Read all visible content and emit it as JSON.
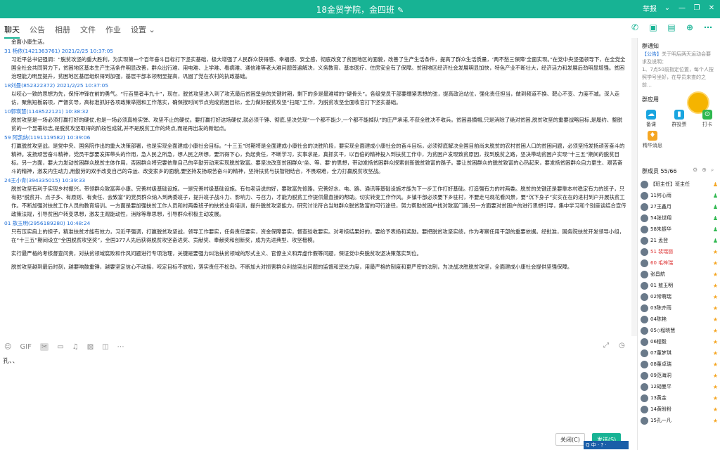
{
  "window": {
    "title": "18金贸学院，金四班",
    "edit_icon": "pencil-icon"
  },
  "window_controls": [
    "举报",
    "⌄",
    "—",
    "❐",
    "✕"
  ],
  "tabs": [
    "聊天",
    "公告",
    "相册",
    "文件",
    "作业",
    "设置 ⌄"
  ],
  "active_tab": "聊天",
  "quick_tools": [
    "phone-icon",
    "video-icon",
    "screen-share-icon",
    "add-icon",
    "more-icon"
  ],
  "messages": [
    {
      "name": "",
      "time": "",
      "lines": [
        "金面小康生活。"
      ]
    },
    {
      "name": "31  杨依(1421363761)",
      "time": "2021/2/25 10:37:05",
      "lines": [
        "习近平总书记强调：“脱贫攻坚的重大胜利，为实现第一个百年奋斗目标打下坚实基础，极大增强了人民群众获得感、幸福感、安全感，彻底改变了贫困地区的面貌，改善了生产生活条件，提高了群众生活质量，‘两不愁三保障’全面实现。”在党中央坚强领导下，在全党全国全社会共同努力下，贫困地区基本生产生活条件明显改善，群众出行难、用电难、上学难、看病难、通信难等老大难问题普遍解决，义务教育、基本医疗、住房安全有了保障。贫困地区经济社会发展明显加快，特色产业不断壮大，经济活力和发展后劲明显增强。贫困治理能力明显提升，贫困地区基层组织得到加强，基层干部本领明显提高，巩固了党在农村的执政基础。"
      ]
    },
    {
      "name": "18刘曼(852322372)",
      "time": "2021/2/25 10:37:05",
      "lines": [
        "以咬心一致的思想为先，保持冲锋在前的勇气。“行百里者半九十”，现在，脱贫攻坚进入到了攻克最后贫困堡垒的关键时期，剩下的多是最难啃的“硬骨头”。各级党员干部要绷紧思想的弦，提高政治站位，强化责任担当，做到频道不换、靶心不变、力度不减。深入走访，聚焦短板弱项，严督实导，高标准抓好各项政策举措和工作落实，确保按时间节点完成贫困目标，全力做好脱贫攻坚“扫尾”工作，为脱贫攻坚全面收官打下坚实基础。"
      ]
    },
    {
      "name": "10郭瑛慧(1148522121)",
      "time": "10:38:32",
      "lines": [
        "脱贫攻坚是一场必须打赢打好的硬仗,也是一场必须真枪实弹、攻坚不止的硬仗。要打赢打好这场硬仗,就必须千锤、彻底,坚决兑现“一个都不能少,一个都不能掉队”的庄严承诺,不获全胜决不收兵。贫困县摘帽,只是消除了绝对贫困,脱贫攻坚的重要战略目标,是履约、整脱贫的一个显著标志,是脱贫攻坚取得的阶段性成就,并不是脱贫工作的终点,而是再出发的新起点。"
      ]
    },
    {
      "name": "59  阿凯纳(1191119582)",
      "time": "10:39:06",
      "lines": [
        "打赢脱贫攻坚战，是党中央、国务院作出的重大决策部署，也是实现全面建成小康社会目标。“十三五”时期将是全面建成小康社会的决胜阶段，要实现全面建成小康社会的奋斗目标，必须彻底解决全国目前尚未脱贫的农村贫困人口的贫困问题，必须坚持发扬顽苦奋斗的精神。发扬顽苦奋斗精神，党员干部要发挥带头的作用，急人民之所急，想人民之所想，要沉得下心，负起责任，不断学习，实事求是，真抓实干，以百倍的精神投入到扶贫工作中，为贫困户发现致贫原因，找到脱贫之路，坚决带动贫困户实现“十三五”期间的脱贫目标。另一方面，要大力发动贫困群众脱贫主体作用，否困群众将完要依靠自己的辛勤劳动来实现脱贫致富。要坚决改变贫困群众‘坐、等、要’的思想，带动发扬贫困群众探索创新脱贫致富的路子。要让贫困群众的脱贫致富的心热起来，要发扬贫困群众自力更生、艰苦奋斗的精神，激发内生动力,用勤劳的双手改变自己的命运、改变家乡的面貌,要坚持发扬艰苦奋斗的精神，坚持扶贫与扶智相结合，不畏艰难，全力打赢脱贫攻坚战。"
      ]
    },
    {
      "name": "24王小青(394335015)",
      "time": "10:39:33",
      "lines": [
        "脱贫攻坚有利于实现乡村振兴，带领群众致富奔小康。完善村级基础设施。一是完善村级基础设施。有句老话说的好，要致富先修路。完善好水、电、路、通讯等基础设施才能为下一步工作打好基础。打造强有力的村两委。脱贫的关键还是要靠本村稳定有力的班子，只有把“脱贫开、点子多、有原则、有责任、会致富”的党员群众纳入到两委班子，提升班子战斗力、影响力、号召力，才能为脱贫工作提供最直接的帮助。切实转变工作作风。乡镇干部必须要下乡驻村，不要走马观花看风景，要“沉下身子”实实在在的进村到户开展扶贫工作。不断加强对扶贫工作人员的教育培训。一方面是要加强扶贫工作人员和村两委班子的扶贫业务培训，提升脱贫攻坚能力，研究讨论符合当地群众脱贫致富的可行途径，努力帮助贫困户找对致富门路;另一方面要对贫困户的进行思想引导，集中学习和个别座谈结合宣传政策法规，引导贫困户转变思想，激发主观能动性，消除等靠思想，引导群众积极主动发展。"
      ]
    },
    {
      "name": "01  敖玉明(2956189280)",
      "time": "10:48:24",
      "lines": [
        "只有压实肩上的担子，精准扶贫才能有效力，习近平强调，打赢脱贫攻坚战，领导工作要实，任务责任要实，资金保障要实，督查验收要实。对考核结果好的，要给予表扬和奖励。要把脱贫攻坚实绩，作为考察任用干部的重要依据。经批准，国务院扶贫开发领导小组，在“十三五”期间设立“全国脱贫攻坚奖”，全国377人先后获得脱贫攻坚奋进奖、贡献奖、奉献奖和创新奖，成为先进典型、攻坚楷模。",
        "实行最严格的考核督查问责，对扶贫领域腐败和作风问题进行专项治理，关键是要强力纠治扶贫领域的形式主义、官僚主义和弄虚作假等问题，保证党中央脱贫攻坚决策落实到位。",
        "脱贫攻坚越到最后时刻，越要响鼓重锤，越要坚定信心不动摇，咬定目标不放松，落实责任不松劲。不断加大对损害群众利益突出问题的监督和惩处力度，用最严格的制度和更严密的法制，为决战决胜脱贫攻坚，全面建成小康社会提供坚强保障。"
      ]
    }
  ],
  "input_toolbar": [
    "☺",
    "GIF",
    "✂",
    "▭",
    "♫",
    "▨",
    "◫",
    "⋯"
  ],
  "input_right_tools": [
    "⤢",
    "◷"
  ],
  "input_text": "孔、、",
  "buttons": {
    "close": "关闭(C)",
    "send": "发送(S)"
  },
  "ime": "Q 中 · ? ·",
  "notice": {
    "title": "群通知",
    "key": "【公告】",
    "text": "关于明后两天运动会要求及说明：",
    "line2": "1、7点50前指定位置，每个人按照学号坐好，在导员来查的之前…"
  },
  "apps_title": "群应用",
  "apps": [
    "备课",
    "群投票",
    "打卡",
    "精华消息"
  ],
  "members_title": "群成员 55/66",
  "members": [
    {
      "name": "【班主任】班主任",
      "red": false
    },
    {
      "name": "11何心雨",
      "red": false
    },
    {
      "name": "27王鑫月",
      "red": false
    },
    {
      "name": "54张世翔",
      "red": false
    },
    {
      "name": "58朱振华",
      "red": false
    },
    {
      "name": "21  孟登",
      "red": false
    },
    {
      "name": "51  裴瑞丽",
      "red": true
    },
    {
      "name": "60  毛梓瑞",
      "red": true
    },
    {
      "name": "张昌航",
      "red": false
    },
    {
      "name": "01  敖玉明",
      "red": false
    },
    {
      "name": "02常萌瑞",
      "red": false
    },
    {
      "name": "03陈齐雨",
      "red": false
    },
    {
      "name": "04陈艳",
      "red": false
    },
    {
      "name": "05◇程晓慧",
      "red": false
    },
    {
      "name": "06程毅",
      "red": false
    },
    {
      "name": "07董梦琪",
      "red": false
    },
    {
      "name": "08董卓瑞",
      "red": false
    },
    {
      "name": "09范海洞",
      "red": false
    },
    {
      "name": "12胡曼平",
      "red": false
    },
    {
      "name": "13黄金",
      "red": false
    },
    {
      "name": "14黄盼粉",
      "red": false
    },
    {
      "name": "15孔一凡",
      "red": false
    }
  ]
}
